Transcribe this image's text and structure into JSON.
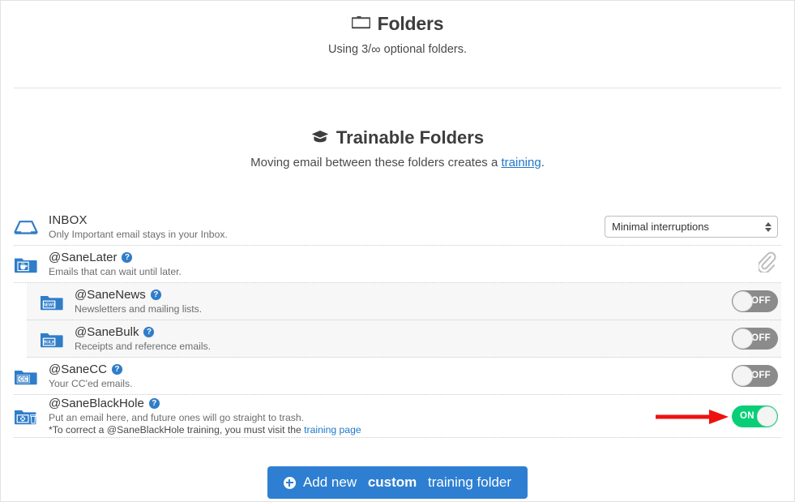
{
  "folders_section": {
    "icon": "folder-open-icon",
    "title": "Folders",
    "usage_prefix": "Using 3/",
    "usage_infinity": "∞",
    "usage_suffix": "optional folders."
  },
  "trainable_section": {
    "icon": "graduation-cap-icon",
    "title": "Trainable Folders",
    "subtitle_prefix": "Moving email between these folders creates a ",
    "subtitle_link": "training",
    "subtitle_suffix": "."
  },
  "rows": [
    {
      "id": "inbox",
      "icon": "inbox-tray-icon",
      "name": "INBOX",
      "description": "Only Important email stays in your Inbox.",
      "has_help": false,
      "control": "select",
      "select_value": "Minimal interruptions",
      "indented": false
    },
    {
      "id": "sanelater",
      "icon": "folder-coffee-icon",
      "name": "@SaneLater",
      "description": "Emails that can wait until later.",
      "has_help": true,
      "help_label": "?",
      "control": "paperclip",
      "indented": false
    },
    {
      "id": "sanenews",
      "icon": "folder-news-icon",
      "icon_tag": "NEWS",
      "name": "@SaneNews",
      "description": "Newsletters and mailing lists.",
      "has_help": true,
      "help_label": "?",
      "control": "toggle",
      "toggle_state": "OFF",
      "indented": true
    },
    {
      "id": "sanebulk",
      "icon": "folder-bulk-icon",
      "icon_tag": "BULK",
      "name": "@SaneBulk",
      "description": "Receipts and reference emails.",
      "has_help": true,
      "help_label": "?",
      "control": "toggle",
      "toggle_state": "OFF",
      "indented": true
    },
    {
      "id": "sanecc",
      "icon": "folder-cc-icon",
      "icon_tag": "CC",
      "name": "@SaneCC",
      "description": "Your CC'ed emails.",
      "has_help": true,
      "help_label": "?",
      "control": "toggle",
      "toggle_state": "OFF",
      "indented": false
    },
    {
      "id": "saneblackhole",
      "icon": "folder-blackhole-icon",
      "name": "@SaneBlackHole",
      "description": "Put an email here, and future ones will go straight to trash.",
      "note_prefix": "*To correct a @SaneBlackHole training, you must visit the ",
      "note_link": "training page",
      "has_help": true,
      "help_label": "?",
      "control": "toggle",
      "toggle_state": "ON",
      "indented": false,
      "annotated": true
    }
  ],
  "add_button": {
    "icon": "plus-circle-icon",
    "text_part1": "Add new ",
    "text_bold": "custom",
    "text_part2": " training folder"
  },
  "colors": {
    "brand_blue": "#2e7fd1",
    "link_blue": "#2078c9",
    "toggle_on_green": "#08cf77",
    "toggle_off_gray": "#8b8b8b",
    "annotation_red": "#ee1111",
    "icon_blue": "#2f7dc9"
  }
}
